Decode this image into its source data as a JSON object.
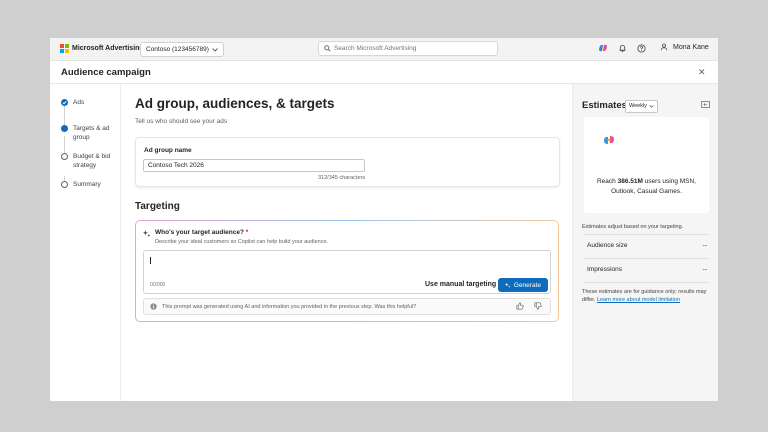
{
  "topbar": {
    "brand": "Microsoft Advertising",
    "account": "Contoso (123456789)",
    "search_placeholder": "Search Microsoft Advertising",
    "user_name": "Mona Kane"
  },
  "page": {
    "title": "Audience campaign"
  },
  "steps": [
    {
      "label": "Ads",
      "state": "done"
    },
    {
      "label": "Targets & ad group",
      "state": "current"
    },
    {
      "label": "Budget & bid strategy",
      "state": "todo"
    },
    {
      "label": "Summary",
      "state": "todo"
    }
  ],
  "main": {
    "heading": "Ad group, audiences, & targets",
    "subheading": "Tell us who should see your ads",
    "ad_group": {
      "label": "Ad group name",
      "value": "Contoso Tech 2026",
      "count": "312/345 characters"
    },
    "targeting": {
      "heading": "Targeting",
      "question": "Who's your target audience?",
      "required_mark": "*",
      "helper": "Describe your ideal customers so Copilot can help build your audience.",
      "textarea_value": "",
      "char_count": "0/2000",
      "manual_label": "Use manual targeting",
      "generate_label": "Generate",
      "feedback_text": "This prompt was generated using AI and information you provided in the previous step. Was this helpful?"
    }
  },
  "estimates": {
    "title": "Estimates",
    "period": "Weekly",
    "reach_prefix": "Reach ",
    "reach_value": "386.51M",
    "reach_suffix": " users using MSN, Outlook, Casual Games.",
    "adjust_note": "Estimates adjust based on your targeting.",
    "metrics": [
      {
        "label": "Audience size",
        "value": "--"
      },
      {
        "label": "Impressions",
        "value": "--"
      }
    ],
    "disclaimer": "These estimates are for guidance only; results may differ. ",
    "disclaimer_link": "Learn more about model limitation"
  },
  "colors": {
    "accent": "#0f6cbd",
    "ms_red": "#f25022",
    "ms_green": "#7fba00",
    "ms_blue": "#00a4ef",
    "ms_yellow": "#ffb900"
  }
}
